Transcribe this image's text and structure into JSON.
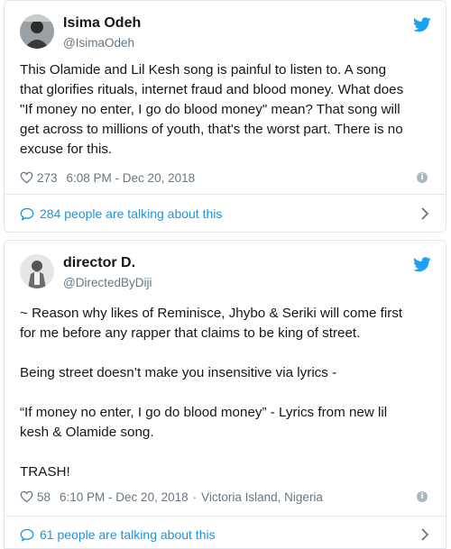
{
  "colors": {
    "accent": "#1da1f2",
    "link": "#1b95e0",
    "muted": "#657786",
    "text": "#14171a",
    "border": "#e1e8ed"
  },
  "tweets": [
    {
      "name": "Isima Odeh",
      "handle": "@IsimaOdeh",
      "text": "This Olamide and Lil Kesh song is painful to listen to. A song\nthat glorifies rituals, internet fraud and blood money. What does\n\"If money no enter, I go do blood money\" mean? That song will\nget across to millions of youth, that's the worst part. There is no\nexcuse for this.",
      "likes": "273",
      "timestamp": "6:08 PM - Dec 20, 2018",
      "location": "",
      "talking": "284 people are talking about this",
      "icons": {
        "like": "heart-icon",
        "brand": "twitter-bird-icon",
        "info": "info-icon",
        "reply": "speech-bubble-icon",
        "more": "chevron-right-icon"
      }
    },
    {
      "name": "director D.",
      "handle": "@DirectedByDiji",
      "text": "~ Reason why likes of Reminisce, Jhybo & Seriki will come first\nfor me before any rapper that claims to be king of street.\n\nBeing street doesn’t make you insensitive via lyrics -\n\n“If money no enter, I go do blood money” - Lyrics from new lil\nkesh & Olamide song.\n\nTRASH!",
      "likes": "58",
      "timestamp": "6:10 PM - Dec 20, 2018",
      "location": "Victoria Island, Nigeria",
      "talking": "61 people are talking about this",
      "icons": {
        "like": "heart-icon",
        "brand": "twitter-bird-icon",
        "info": "info-icon",
        "reply": "speech-bubble-icon",
        "more": "chevron-right-icon"
      }
    }
  ]
}
